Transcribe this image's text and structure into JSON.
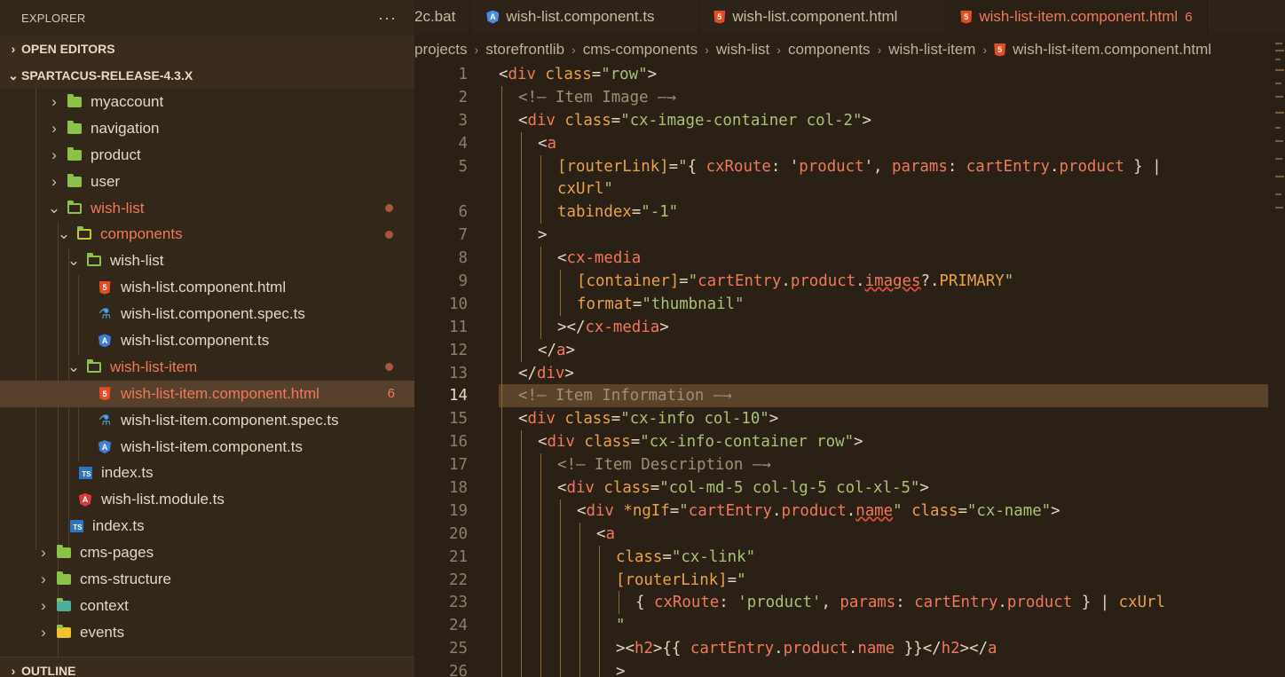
{
  "sidebar": {
    "title": "EXPLORER",
    "more_label": "···",
    "open_editors": "OPEN EDITORS",
    "project": "SPARTACUS-RELEASE-4.3.X",
    "outline": "OUTLINE",
    "tree": [
      {
        "label": "myaccount",
        "icon": "folder",
        "expanded": false
      },
      {
        "label": "navigation",
        "icon": "folder",
        "expanded": false
      },
      {
        "label": "product",
        "icon": "folder",
        "expanded": false
      },
      {
        "label": "user",
        "icon": "folder",
        "expanded": false
      },
      {
        "label": "wish-list",
        "icon": "folder-open",
        "expanded": true,
        "modified": true
      },
      {
        "label": "components",
        "icon": "folder-components",
        "expanded": true,
        "modified": true
      },
      {
        "label": "wish-list",
        "icon": "folder-open",
        "expanded": true
      },
      {
        "label": "wish-list.component.html",
        "icon": "html5"
      },
      {
        "label": "wish-list.component.spec.ts",
        "icon": "flask"
      },
      {
        "label": "wish-list.component.ts",
        "icon": "angular"
      },
      {
        "label": "wish-list-item",
        "icon": "folder-open",
        "expanded": true,
        "modified": true
      },
      {
        "label": "wish-list-item.component.html",
        "icon": "html5",
        "problems": "6",
        "selected": true
      },
      {
        "label": "wish-list-item.component.spec.ts",
        "icon": "flask"
      },
      {
        "label": "wish-list-item.component.ts",
        "icon": "angular"
      },
      {
        "label": "index.ts",
        "icon": "typescript"
      },
      {
        "label": "wish-list.module.ts",
        "icon": "angular-red"
      },
      {
        "label": "index.ts",
        "icon": "typescript"
      },
      {
        "label": "cms-pages",
        "icon": "folder",
        "expanded": false
      },
      {
        "label": "cms-structure",
        "icon": "folder",
        "expanded": false
      },
      {
        "label": "context",
        "icon": "folder-context",
        "expanded": false
      },
      {
        "label": "events",
        "icon": "folder-events",
        "expanded": false
      }
    ]
  },
  "tabs": [
    {
      "label": "2c.bat",
      "icon": "none"
    },
    {
      "label": "wish-list.component.ts",
      "icon": "angular"
    },
    {
      "label": "wish-list.component.html",
      "icon": "html5"
    },
    {
      "label": "wish-list-item.component.html",
      "icon": "html5",
      "active": true,
      "problems": "6"
    }
  ],
  "breadcrumbs": [
    "projects",
    "storefrontlib",
    "cms-components",
    "wish-list",
    "components",
    "wish-list-item",
    "wish-list-item.component.html"
  ],
  "editor": {
    "current_line": "14",
    "lines": [
      {
        "n": "1",
        "text": "<div class=\"row\">"
      },
      {
        "n": "2",
        "text": "<!-- Item Image -->"
      },
      {
        "n": "3",
        "text": "<div class=\"cx-image-container col-2\">"
      },
      {
        "n": "4",
        "text": "<a"
      },
      {
        "n": "5",
        "text": "[routerLink]=\"{ cxRoute: 'product', params: cartEntry.product } |"
      },
      {
        "n": "",
        "text": "cxUrl\""
      },
      {
        "n": "6",
        "text": "tabindex=\"-1\""
      },
      {
        "n": "7",
        "text": ">"
      },
      {
        "n": "8",
        "text": "<cx-media"
      },
      {
        "n": "9",
        "text": "[container]=\"cartEntry.product.images?.PRIMARY\""
      },
      {
        "n": "10",
        "text": "format=\"thumbnail\""
      },
      {
        "n": "11",
        "text": "></cx-media>"
      },
      {
        "n": "12",
        "text": "</a>"
      },
      {
        "n": "13",
        "text": "</div>"
      },
      {
        "n": "14",
        "text": "<!-- Item Information -->"
      },
      {
        "n": "15",
        "text": "<div class=\"cx-info col-10\">"
      },
      {
        "n": "16",
        "text": "<div class=\"cx-info-container row\">"
      },
      {
        "n": "17",
        "text": "<!-- Item Description -->"
      },
      {
        "n": "18",
        "text": "<div class=\"col-md-5 col-lg-5 col-xl-5\">"
      },
      {
        "n": "19",
        "text": "<div *ngIf=\"cartEntry.product.name\" class=\"cx-name\">"
      },
      {
        "n": "20",
        "text": "<a"
      },
      {
        "n": "21",
        "text": "class=\"cx-link\""
      },
      {
        "n": "22",
        "text": "[routerLink]=\""
      },
      {
        "n": "23",
        "text": "{ cxRoute: 'product', params: cartEntry.product } | cxUrl"
      },
      {
        "n": "24",
        "text": "\""
      },
      {
        "n": "25",
        "text": "><h2>{{ cartEntry.product.name }}</h2></a"
      },
      {
        "n": "26",
        "text": ">"
      }
    ]
  },
  "colors": {
    "sidebar_bg": "#322719",
    "editor_bg": "#2a2016",
    "accent_modified": "#f0795a",
    "folder_green": "#8bc34a",
    "string_green": "#a9c274",
    "attr_orange": "#e8a348",
    "line_highlight": "#5b4329"
  }
}
